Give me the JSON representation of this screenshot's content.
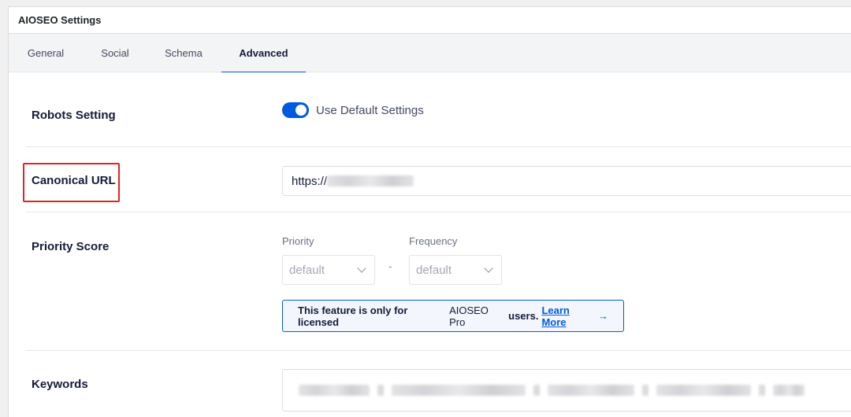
{
  "panel": {
    "title": "AIOSEO Settings"
  },
  "tabs": [
    {
      "label": "General"
    },
    {
      "label": "Social"
    },
    {
      "label": "Schema"
    },
    {
      "label": "Advanced",
      "active": true
    }
  ],
  "robots": {
    "label": "Robots Setting",
    "toggle_label": "Use Default Settings",
    "toggle_on": true
  },
  "canonical": {
    "label": "Canonical URL",
    "value": "https://"
  },
  "priority": {
    "label": "Priority Score",
    "priority_caption": "Priority",
    "priority_value": "default",
    "separator": "-",
    "frequency_caption": "Frequency",
    "frequency_value": "default"
  },
  "notice": {
    "text_pre": "This feature is only for licensed",
    "text_mid": "AIOSEO Pro",
    "text_post": "users.",
    "link": "Learn More",
    "arrow": "→"
  },
  "keywords": {
    "label": "Keywords"
  },
  "colors": {
    "accent": "#005ae0",
    "highlight": "#e02424"
  }
}
